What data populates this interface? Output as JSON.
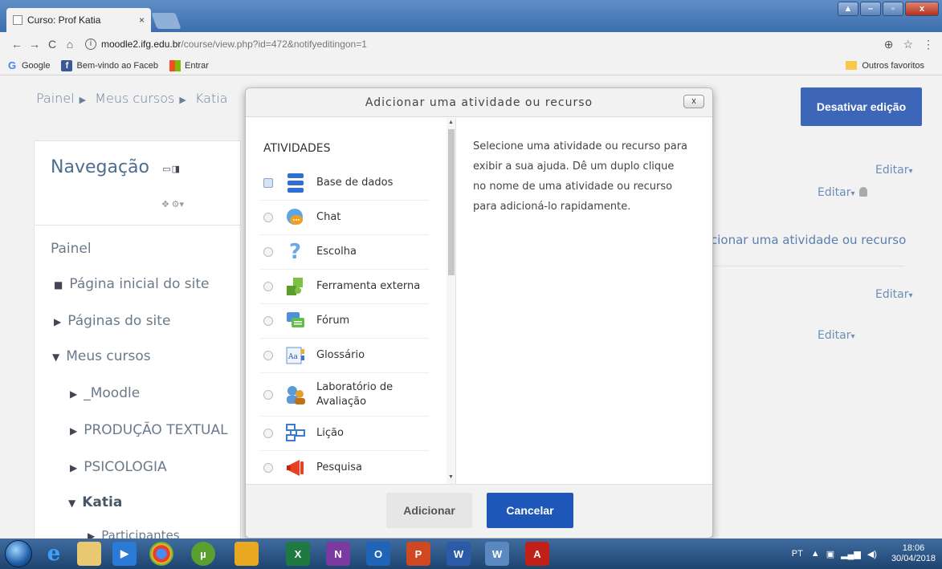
{
  "browser": {
    "tab_title": "Curso: Prof Katia",
    "tab_close": "×",
    "url_host": "moodle2.ifg.edu.br",
    "url_path": "/course/view.php?id=472&notifyeditingon=1",
    "bookmarks": [
      "Google",
      "Bem-vindo ao Faceb",
      "Entrar"
    ],
    "other_bookmarks": "Outros favoritos"
  },
  "breadcrumb": [
    "Painel",
    "Meus cursos",
    "Katia"
  ],
  "navigation": {
    "title": "Navegação",
    "items": [
      {
        "label": "Painel",
        "marker": ""
      },
      {
        "label": "Página inicial do site",
        "marker": "■"
      },
      {
        "label": "Páginas do site",
        "marker": "▶"
      },
      {
        "label": "Meus cursos",
        "marker": "▼"
      },
      {
        "label": "_Moodle",
        "marker": "▶"
      },
      {
        "label": "PRODUÇÃO TEXTUAL",
        "marker": "▶"
      },
      {
        "label": "PSICOLOGIA",
        "marker": "▶"
      },
      {
        "label": "Katia",
        "marker": "▼"
      },
      {
        "label": "Participantes",
        "marker": "▶"
      }
    ]
  },
  "page": {
    "editing_button": "Desativar edição",
    "edit_label": "Editar",
    "add_activity_link": "cionar uma atividade ou recurso"
  },
  "modal": {
    "title": "Adicionar uma atividade ou recurso",
    "close": "x",
    "section_title": "ATIVIDADES",
    "options": [
      {
        "label": "Base de dados",
        "icon": "database-icon"
      },
      {
        "label": "Chat",
        "icon": "chat-icon"
      },
      {
        "label": "Escolha",
        "icon": "question-icon"
      },
      {
        "label": "Ferramenta externa",
        "icon": "puzzle-icon"
      },
      {
        "label": "Fórum",
        "icon": "forum-icon"
      },
      {
        "label": "Glossário",
        "icon": "glossary-icon"
      },
      {
        "label": "Laboratório de Avaliação",
        "icon": "workshop-icon"
      },
      {
        "label": "Lição",
        "icon": "lesson-icon"
      },
      {
        "label": "Pesquisa",
        "icon": "megaphone-icon"
      }
    ],
    "help_text": "Selecione uma atividade ou recurso para exibir a sua ajuda. Dê um duplo clique no nome de uma atividade ou recurso para adicioná-lo rapidamente.",
    "add_button": "Adicionar",
    "cancel_button": "Cancelar"
  },
  "taskbar": {
    "language": "PT",
    "time": "18:06",
    "date": "30/04/2018"
  },
  "colors": {
    "primary": "#1f57b8",
    "editing_button": "#3e66b8",
    "link": "#6b8fb8"
  }
}
